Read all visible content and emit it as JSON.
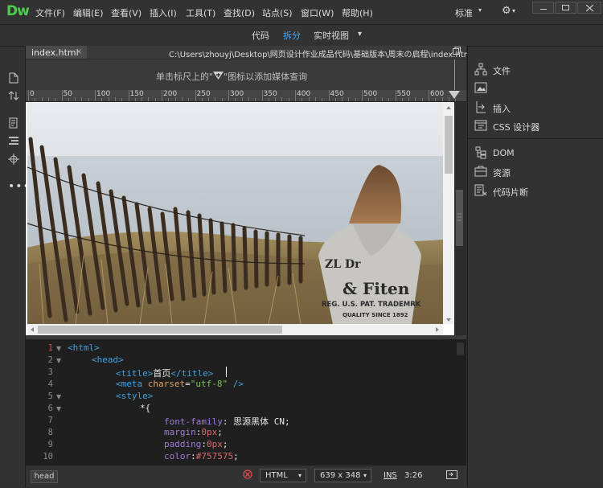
{
  "app": {
    "logo": "Dw"
  },
  "menu": {
    "items": [
      "文件(F)",
      "编辑(E)",
      "查看(V)",
      "插入(I)",
      "工具(T)",
      "查找(D)",
      "站点(S)",
      "窗口(W)",
      "帮助(H)"
    ]
  },
  "workspace": {
    "label": "标准",
    "caret": "▾",
    "gear": "⚙",
    "gear_caret": "▾"
  },
  "views": {
    "code": "代码",
    "split": "拆分",
    "live": "实时视图",
    "live_caret": "▾"
  },
  "document": {
    "tab": "index.html",
    "close": "×",
    "path": "C:\\Users\\zhouyj\\Desktop\\网页设计作业成品代码\\基础版本\\周末の启程\\index.html"
  },
  "media_query": {
    "prefix": "单击标尺上的\"",
    "suffix": "\"图标以添加媒体查询"
  },
  "ruler": {
    "labels": [
      "0",
      "50",
      "100",
      "150",
      "200",
      "250",
      "300",
      "350",
      "400",
      "450",
      "500",
      "550",
      "600"
    ]
  },
  "photo": {
    "hoodie_line1": "& Fiten",
    "hoodie_line2": "REG. U.S. PAT. TRADEMRK",
    "hoodie_line3": "QUALITY SINCE 1892",
    "hoodie_top": "ZL Dr"
  },
  "code": {
    "line_numbers": [
      "1",
      "2",
      "3",
      "4",
      "5",
      "6",
      "7",
      "8",
      "9",
      "10"
    ],
    "l1": {
      "tag": "<html>"
    },
    "l2": {
      "tag": "<head>"
    },
    "l3": {
      "open": "<title>",
      "text": "首页",
      "close": "</title>"
    },
    "l4": {
      "open": "<meta ",
      "attr": "charset",
      "eq": "=",
      "str": "\"utf-8\"",
      "end": " />"
    },
    "l5": {
      "tag": "<style>"
    },
    "l6": {
      "text": "*{"
    },
    "l7": {
      "prop": "font-family",
      "colon": ": ",
      "val": "思源黑体 CN",
      "semi": ";"
    },
    "l8": {
      "prop": "margin",
      "colon": ":",
      "val": "0px",
      "semi": ";"
    },
    "l9": {
      "prop": "padding",
      "colon": ":",
      "val": "0px",
      "semi": ";"
    },
    "l10": {
      "prop": "color",
      "colon": ":",
      "val": "#757575",
      "semi": ";"
    }
  },
  "status": {
    "tag": "head",
    "language": "HTML",
    "size": "639 x 348",
    "ins": "INS",
    "position": "3:26"
  },
  "panels": {
    "items": [
      "文件",
      "插入",
      "CSS 设计器",
      "DOM",
      "资源",
      "代码片断"
    ]
  },
  "colors": {
    "accent": "#45a6ff",
    "logo": "#4dcc52"
  }
}
